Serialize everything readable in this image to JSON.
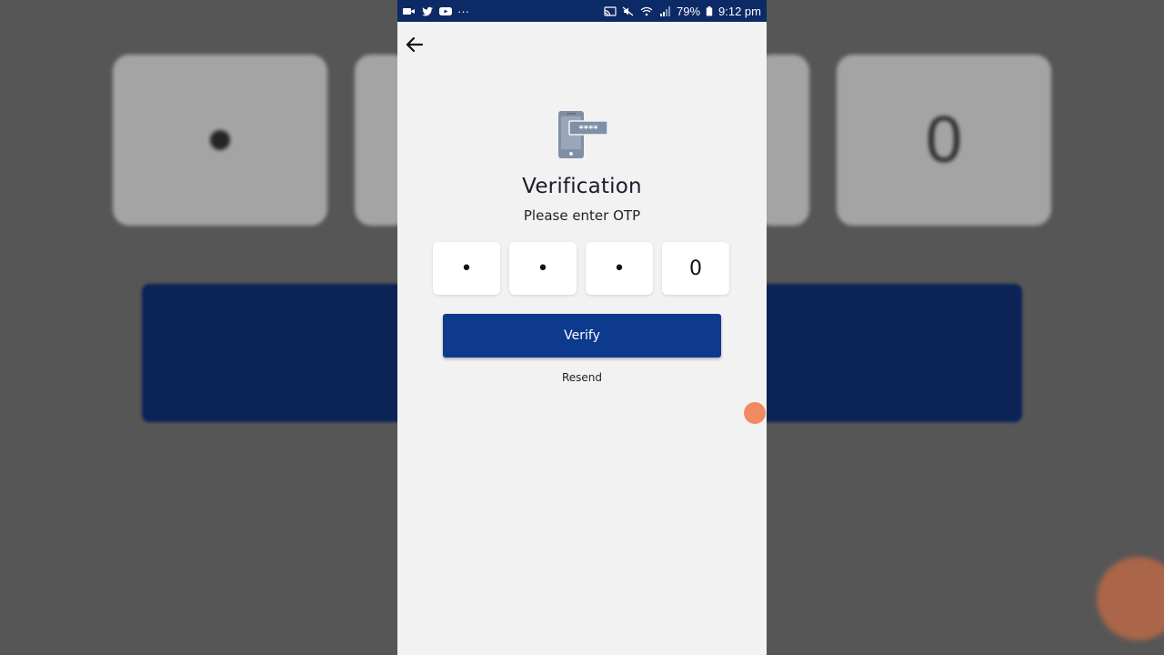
{
  "status_bar": {
    "battery": "79%",
    "time": "9:12 pm",
    "left_icons": [
      "video-app-icon",
      "twitter-icon",
      "youtube-icon",
      "more-dots-icon"
    ],
    "right_icons": [
      "cast-icon",
      "mute-icon",
      "wifi-icon",
      "signal-icon",
      "battery-icon"
    ],
    "more": "···"
  },
  "header": {
    "back_icon": "arrow-left-icon"
  },
  "hero": {
    "icon": "phone-otp-icon",
    "mask": "****"
  },
  "title": "Verification",
  "subtitle": "Please enter OTP",
  "otp": {
    "digits": [
      "•",
      "•",
      "•",
      "0"
    ]
  },
  "verify_label": "Verify",
  "resend_label": "Resend",
  "colors": {
    "status_bar": "#0c2a66",
    "primary_button": "#0d3a8c",
    "screen_bg": "#f2f2f2",
    "floating_badge": "#f08a60"
  },
  "background": {
    "mirror_zero": "0"
  }
}
